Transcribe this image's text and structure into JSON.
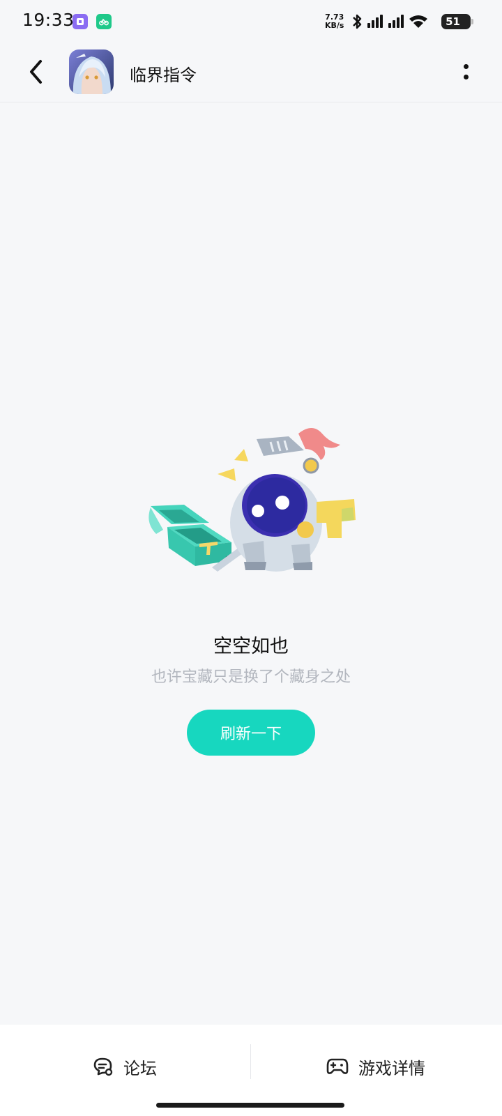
{
  "status_bar": {
    "time": "19:33",
    "net_speed_value": "7.73",
    "net_speed_unit": "KB/s",
    "battery": "51",
    "icons": [
      "bluetooth-icon",
      "signal-icon",
      "signal-icon",
      "wifi-icon",
      "battery-icon"
    ]
  },
  "header": {
    "title": "临界指令",
    "back_icon": "chevron-left-icon",
    "more_icon": "more-vertical-icon"
  },
  "empty_state": {
    "title": "空空如也",
    "subtitle": "也许宝藏只是换了个藏身之处",
    "button_label": "刷新一下"
  },
  "bottom_nav": {
    "forum_label": "论坛",
    "details_label": "游戏详情"
  },
  "colors": {
    "accent": "#17d7bf",
    "background": "#f6f7f9",
    "subtitle": "#b2b6be"
  }
}
